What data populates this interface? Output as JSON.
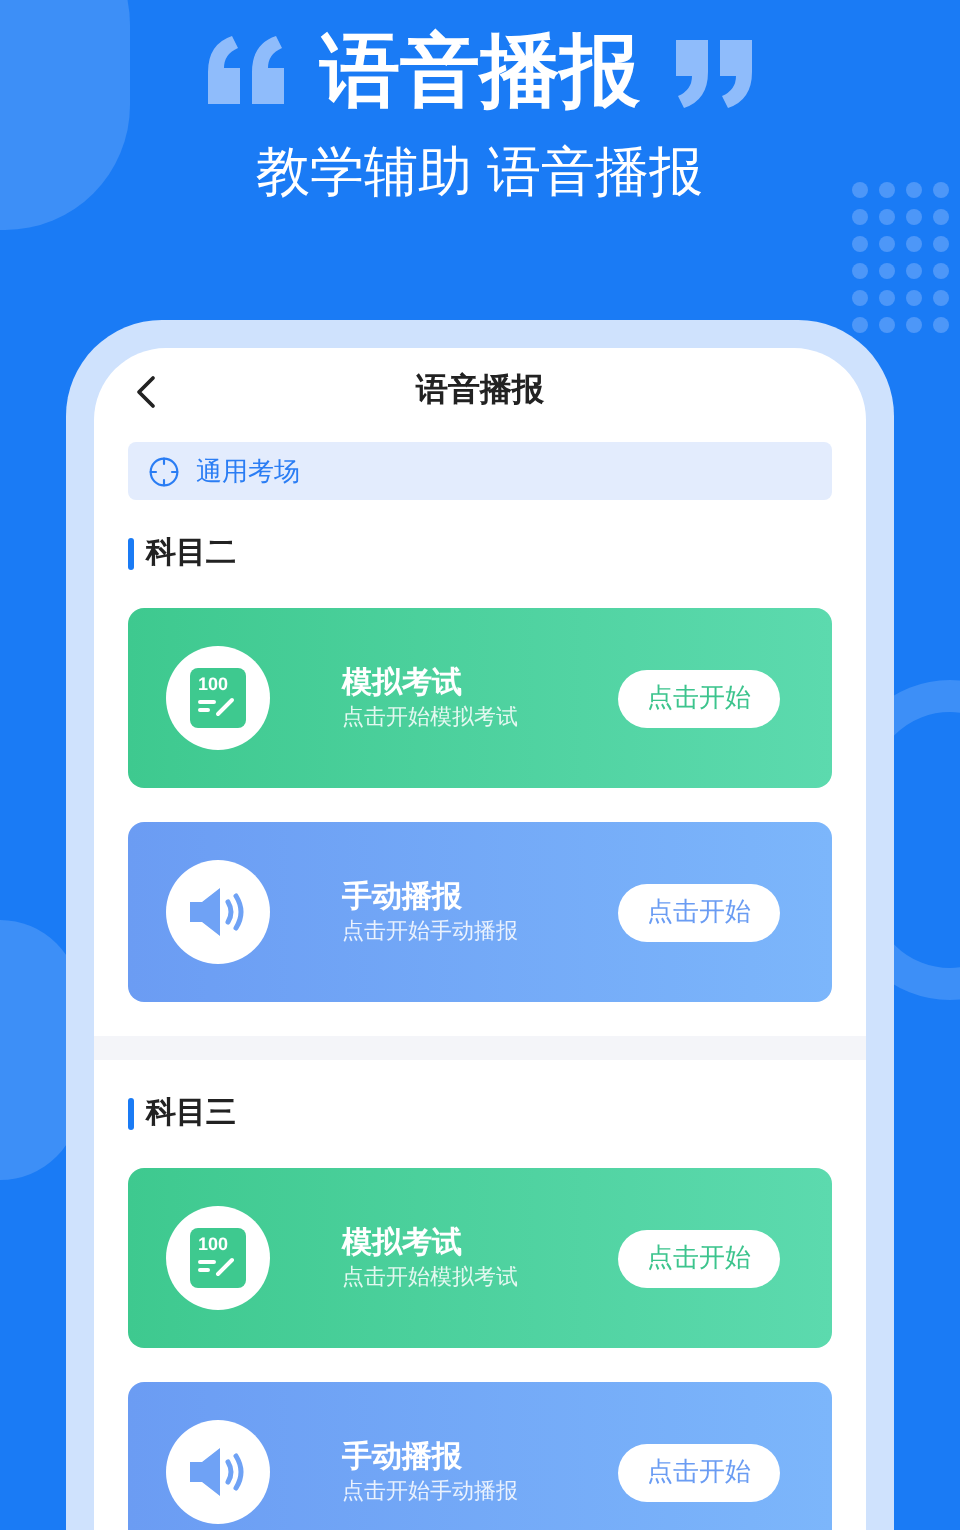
{
  "header": {
    "title": "语音播报",
    "subtitle": "教学辅助 语音播报"
  },
  "screen": {
    "title": "语音播报",
    "location": "通用考场",
    "sections": [
      {
        "title": "科目二",
        "cards": [
          {
            "kind": "exam",
            "icon_text": "100",
            "title": "模拟考试",
            "subtitle": "点击开始模拟考试",
            "button": "点击开始"
          },
          {
            "kind": "voice",
            "title": "手动播报",
            "subtitle": "点击开始手动播报",
            "button": "点击开始"
          }
        ]
      },
      {
        "title": "科目三",
        "cards": [
          {
            "kind": "exam",
            "icon_text": "100",
            "title": "模拟考试",
            "subtitle": "点击开始模拟考试",
            "button": "点击开始"
          },
          {
            "kind": "voice",
            "title": "手动播报",
            "subtitle": "点击开始手动播报",
            "button": "点击开始"
          }
        ]
      }
    ]
  }
}
